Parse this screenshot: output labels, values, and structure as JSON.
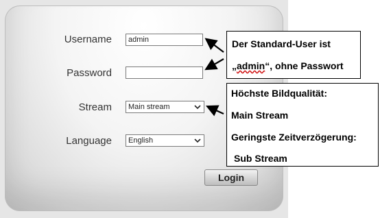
{
  "login_form": {
    "username_label": "Username",
    "username_value": "admin",
    "password_label": "Password",
    "password_value": "",
    "stream_label": "Stream",
    "stream_selected": "Main stream",
    "language_label": "Language",
    "language_selected": "English",
    "login_button": "Login"
  },
  "annotations": {
    "user_note_line1": "Der Standard-User ist",
    "user_note_line2_prefix": "„",
    "user_note_line2_user": "admin",
    "user_note_line2_suffix": "“, ohne Passwort",
    "stream_note_1": "Höchste Bildqualität:",
    "stream_note_2": "Main Stream",
    "stream_note_3": "Geringste Zeitverzögerung:",
    "stream_note_4": "Sub Stream"
  },
  "icons": {
    "dropdown": "chevron-down-icon",
    "arrow": "arrow-icon"
  },
  "colors": {
    "panel": "#f0f0f0",
    "spellcheck_underline": "#cc0000"
  }
}
